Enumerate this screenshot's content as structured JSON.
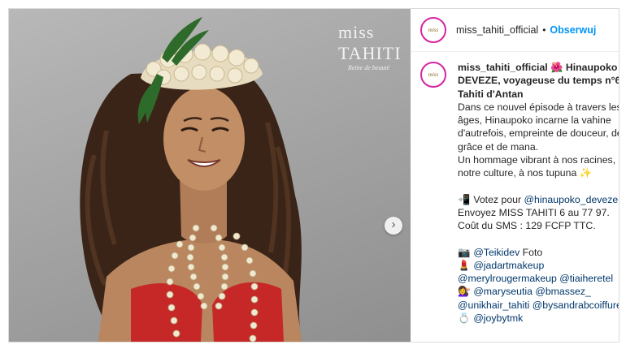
{
  "watermark": {
    "brand": "miss",
    "name": "TAHITI",
    "tagline": "Reine de beauté"
  },
  "carousel": {
    "next_glyph": "›"
  },
  "header": {
    "avatar_text": "miss",
    "username": "miss_tahiti_official",
    "separator": "•",
    "follow_label": "Obserwuj"
  },
  "caption": {
    "avatar_text": "miss",
    "username": "miss_tahiti_official",
    "flower_icon": "🌺",
    "title_1": "Hinaupoko",
    "title_2": "DEVEZE, voyageuse du temps n°6",
    "title_3": "Tahiti d'Antan",
    "lines": [
      "Dans ce nouvel épisode à travers les",
      "âges, Hinaupoko incarne la vahine",
      "d'autrefois, empreinte de douceur, de",
      "grâce et de mana.",
      "Un hommage vibrant à nos racines, à",
      "notre culture, à nos tupuna"
    ],
    "sparkle_icon": "✨",
    "vote_icon": "📲",
    "vote_text": "Votez pour",
    "vote_mention": "@hinaupoko_deveze",
    "sms_line_1": "Envoyez MISS TAHITI 6 au 77 97.",
    "sms_line_2": "Coût du SMS : 129 FCFP TTC.",
    "camera_icon": "📷",
    "photo_mention": "@Teikidev",
    "photo_text": "Foto",
    "lipstick_icon": "💄",
    "makeup_mention": "@jadartmakeup",
    "makeup_mentions_2": "@merylrougermakeup @tiaiheretel",
    "hair_icon": "💇‍♀️",
    "hair_mentions_1": "@maryseutia @bmassez_",
    "hair_mentions_2": "@unikhair_tahiti @bysandrabcoiffure",
    "ring_icon": "💍",
    "jewel_mention": "@joybytmk"
  }
}
